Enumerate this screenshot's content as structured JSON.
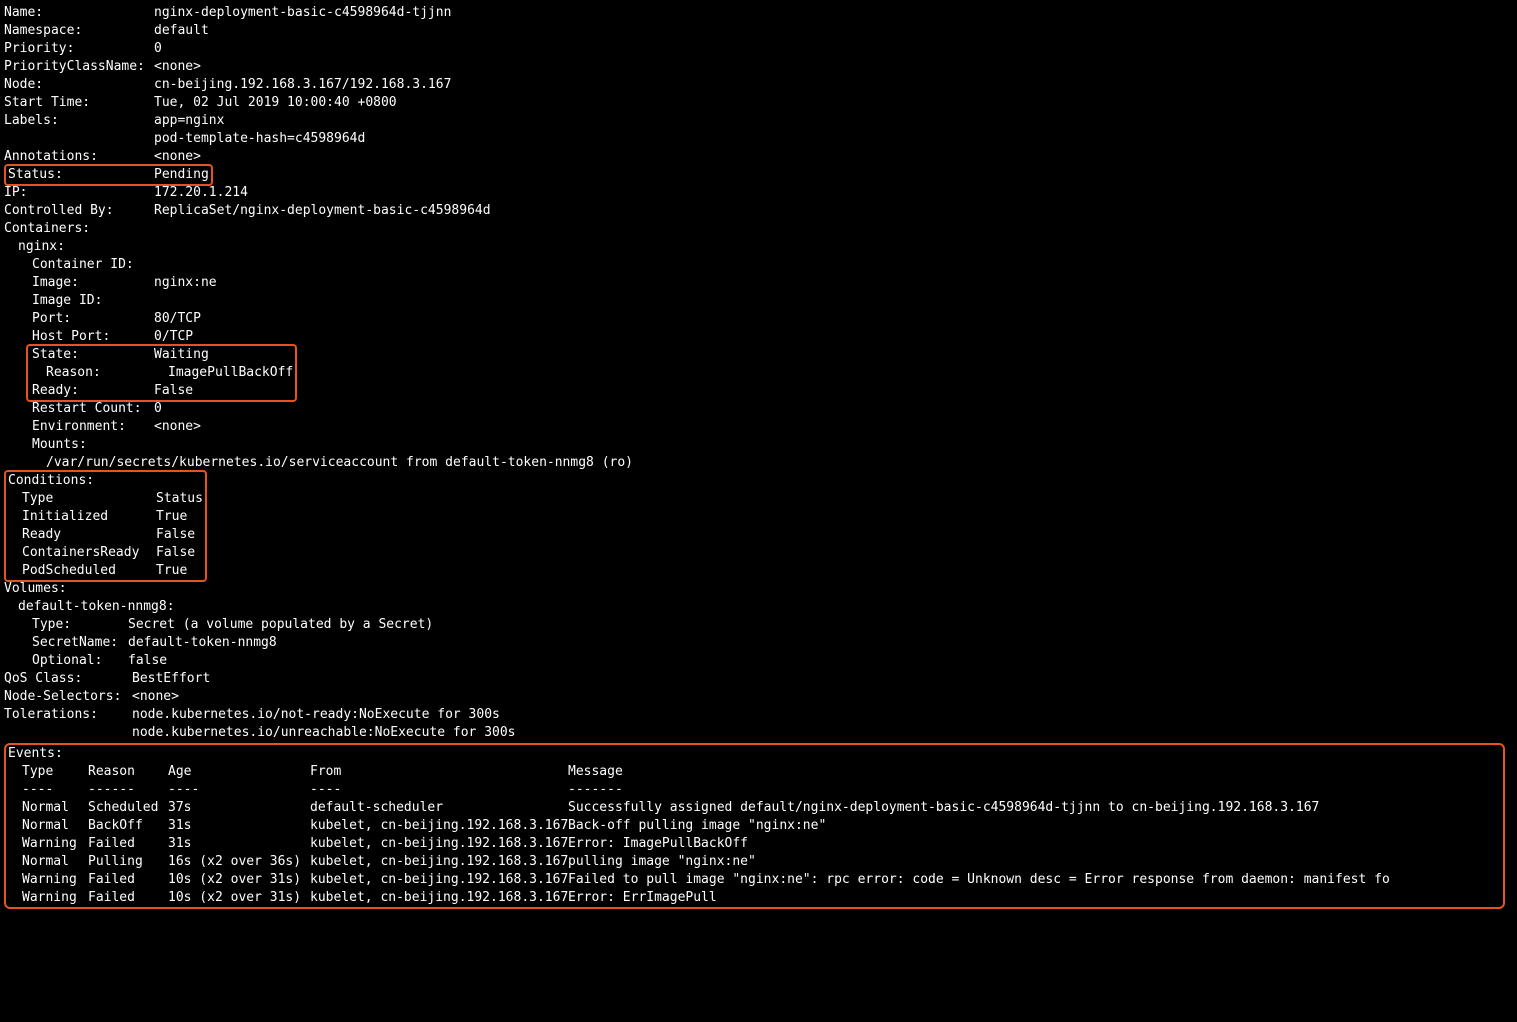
{
  "meta": {
    "name_key": "Name:",
    "name_val": "nginx-deployment-basic-c4598964d-tjjnn",
    "namespace_key": "Namespace:",
    "namespace_val": "default",
    "priority_key": "Priority:",
    "priority_val": "0",
    "priorityclass_key": "PriorityClassName:",
    "priorityclass_val": "<none>",
    "node_key": "Node:",
    "node_val": "cn-beijing.192.168.3.167/192.168.3.167",
    "start_key": "Start Time:",
    "start_val": "Tue, 02 Jul 2019 10:00:40 +0800",
    "labels_key": "Labels:",
    "labels_val1": "app=nginx",
    "labels_val2": "pod-template-hash=c4598964d",
    "annotations_key": "Annotations:",
    "annotations_val": "<none>",
    "status_key": "Status:",
    "status_val": "Pending",
    "ip_key": "IP:",
    "ip_val": "172.20.1.214",
    "controlled_key": "Controlled By:",
    "controlled_val": "ReplicaSet/nginx-deployment-basic-c4598964d",
    "containers_key": "Containers:",
    "qos_key": "QoS Class:",
    "qos_val": "BestEffort",
    "nodesel_key": "Node-Selectors:",
    "nodesel_val": "<none>",
    "tolerations_key": "Tolerations:",
    "tolerations_val1": "node.kubernetes.io/not-ready:NoExecute for 300s",
    "tolerations_val2": "node.kubernetes.io/unreachable:NoExecute for 300s"
  },
  "container": {
    "name": "nginx:",
    "cid_key": "Container ID:",
    "cid_val": "",
    "image_key": "Image:",
    "image_val": "nginx:ne",
    "imageid_key": "Image ID:",
    "imageid_val": "",
    "port_key": "Port:",
    "port_val": "80/TCP",
    "hostport_key": "Host Port:",
    "hostport_val": "0/TCP",
    "state_key": "State:",
    "state_val": "Waiting",
    "reason_key": "Reason:",
    "reason_val": "ImagePullBackOff",
    "ready_key": "Ready:",
    "ready_val": "False",
    "restart_key": "Restart Count:",
    "restart_val": "0",
    "env_key": "Environment:",
    "env_val": "<none>",
    "mounts_key": "Mounts:",
    "mounts_val": "/var/run/secrets/kubernetes.io/serviceaccount from default-token-nnmg8 (ro)"
  },
  "conditions": {
    "header": "Conditions:",
    "col_type": "Type",
    "col_status": "Status",
    "rows": [
      {
        "type": "Initialized",
        "status": "True"
      },
      {
        "type": "Ready",
        "status": "False"
      },
      {
        "type": "ContainersReady",
        "status": "False"
      },
      {
        "type": "PodScheduled",
        "status": "True"
      }
    ]
  },
  "volumes": {
    "header": "Volumes:",
    "vol_name": "default-token-nnmg8:",
    "type_key": "Type:",
    "type_val": "Secret (a volume populated by a Secret)",
    "secret_key": "SecretName:",
    "secret_val": "default-token-nnmg8",
    "optional_key": "Optional:",
    "optional_val": "false"
  },
  "events": {
    "header": "Events:",
    "col_type": "Type",
    "col_reason": "Reason",
    "col_age": "Age",
    "col_from": "From",
    "col_msg": "Message",
    "dash_type": "----",
    "dash_reason": "------",
    "dash_age": "----",
    "dash_from": "----",
    "dash_msg": "-------",
    "rows": [
      {
        "type": "Normal",
        "reason": "Scheduled",
        "age": "37s",
        "from": "default-scheduler",
        "msg": "Successfully assigned default/nginx-deployment-basic-c4598964d-tjjnn to cn-beijing.192.168.3.167"
      },
      {
        "type": "Normal",
        "reason": "BackOff",
        "age": "31s",
        "from": "kubelet, cn-beijing.192.168.3.167",
        "msg": "Back-off pulling image \"nginx:ne\""
      },
      {
        "type": "Warning",
        "reason": "Failed",
        "age": "31s",
        "from": "kubelet, cn-beijing.192.168.3.167",
        "msg": "Error: ImagePullBackOff"
      },
      {
        "type": "Normal",
        "reason": "Pulling",
        "age": "16s (x2 over 36s)",
        "from": "kubelet, cn-beijing.192.168.3.167",
        "msg": "pulling image \"nginx:ne\""
      },
      {
        "type": "Warning",
        "reason": "Failed",
        "age": "10s (x2 over 31s)",
        "from": "kubelet, cn-beijing.192.168.3.167",
        "msg": "Failed to pull image \"nginx:ne\": rpc error: code = Unknown desc = Error response from daemon: manifest fo"
      },
      {
        "type": "Warning",
        "reason": "Failed",
        "age": "10s (x2 over 31s)",
        "from": "kubelet, cn-beijing.192.168.3.167",
        "msg": "Error: ErrImagePull"
      }
    ]
  }
}
